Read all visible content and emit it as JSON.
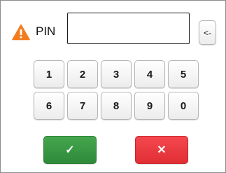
{
  "pin": {
    "label": "PIN",
    "value": "",
    "warning_icon": "warning-triangle-icon",
    "warning_color": "#f47c1f"
  },
  "backspace_label": "<-",
  "keypad": {
    "row1": [
      "1",
      "2",
      "3",
      "4",
      "5"
    ],
    "row2": [
      "6",
      "7",
      "8",
      "9",
      "0"
    ]
  },
  "actions": {
    "ok_label": "✓",
    "ok_icon": "checkmark-icon",
    "ok_color": "#3a9a45",
    "cancel_label": "✕",
    "cancel_icon": "close-icon",
    "cancel_color": "#ec3b41"
  }
}
